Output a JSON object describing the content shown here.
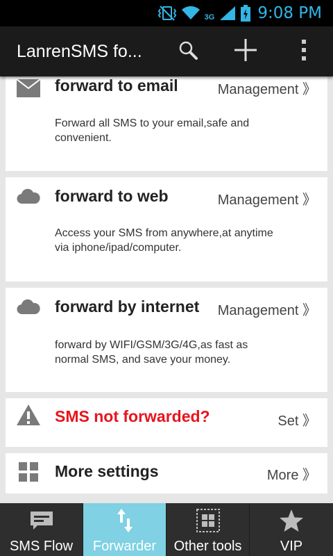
{
  "status_bar": {
    "time": "9:08 PM",
    "network": "3G"
  },
  "action_bar": {
    "title": "LanrenSMS fo...",
    "search_icon": "search-icon",
    "add_icon": "plus-icon",
    "overflow_icon": "overflow-menu-icon"
  },
  "cards": [
    {
      "icon": "email-icon",
      "title": "forward to email",
      "action": "Management 》",
      "description": "Forward all SMS to your email,safe and convenient."
    },
    {
      "icon": "cloud-icon",
      "title": "forward to web",
      "action": "Management 》",
      "description": "Access your SMS from anywhere,at anytime via iphone/ipad/computer."
    },
    {
      "icon": "cloud-icon",
      "title": "forward by internet",
      "action": "Management 》",
      "description": "forward by WIFI/GSM/3G/4G,as fast as normal SMS, and save your money."
    },
    {
      "icon": "warning-icon",
      "title": "SMS not forwarded?",
      "action": "Set 》"
    },
    {
      "icon": "grid-icon",
      "title": "More settings",
      "action": "More 》"
    }
  ],
  "bottom_nav": [
    {
      "label": "SMS Flow",
      "icon": "message-icon",
      "active": false
    },
    {
      "label": "Forwarder",
      "icon": "transfer-arrows-icon",
      "active": true
    },
    {
      "label": "Other tools",
      "icon": "tools-grid-icon",
      "active": false
    },
    {
      "label": "VIP",
      "icon": "star-icon",
      "active": false
    }
  ],
  "colors": {
    "accent": "#33b5e5",
    "active_tab": "#7fd1e3",
    "alert_text": "#e8141d",
    "action_bar": "#1b1b1b"
  }
}
